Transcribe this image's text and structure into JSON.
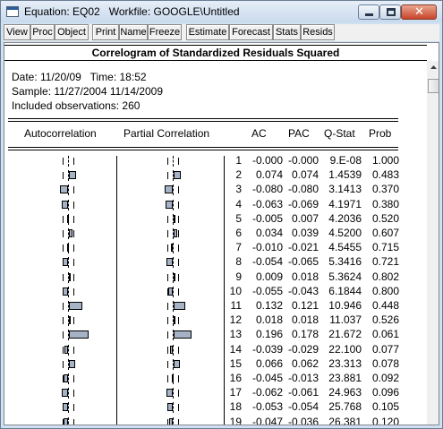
{
  "window": {
    "title": "Equation: EQ02   Workfile: GOOGLE\\Untitled",
    "close_glyph": "✕"
  },
  "toolbar": {
    "buttons": [
      "View",
      "Proc",
      "Object",
      "Print",
      "Name",
      "Freeze",
      "Estimate",
      "Forecast",
      "Stats",
      "Resids"
    ]
  },
  "report": {
    "heading": "Correlogram of Standardized Residuals Squared",
    "date_line": "Date: 11/20/09   Time: 18:52",
    "sample_line": "Sample: 11/27/2004 11/14/2009",
    "obs_line": "Included observations: 260",
    "columns": {
      "autocorrelation": "Autocorrelation",
      "partial_correlation": "Partial Correlation",
      "ac": "AC",
      "pac": "PAC",
      "qstat": "Q-Stat",
      "prob": "Prob"
    }
  },
  "rows": [
    {
      "lag": "1",
      "ac": "-0.000",
      "pac": "-0.000",
      "q": "9.E-08",
      "prob": "1.000",
      "ac_val": -0.0,
      "pac_val": -0.0
    },
    {
      "lag": "2",
      "ac": "0.074",
      "pac": "0.074",
      "q": "1.4539",
      "prob": "0.483",
      "ac_val": 0.074,
      "pac_val": 0.074
    },
    {
      "lag": "3",
      "ac": "-0.080",
      "pac": "-0.080",
      "q": "3.1413",
      "prob": "0.370",
      "ac_val": -0.08,
      "pac_val": -0.08
    },
    {
      "lag": "4",
      "ac": "-0.063",
      "pac": "-0.069",
      "q": "4.1971",
      "prob": "0.380",
      "ac_val": -0.063,
      "pac_val": -0.069
    },
    {
      "lag": "5",
      "ac": "-0.005",
      "pac": "0.007",
      "q": "4.2036",
      "prob": "0.520",
      "ac_val": -0.005,
      "pac_val": 0.007
    },
    {
      "lag": "6",
      "ac": "0.034",
      "pac": "0.039",
      "q": "4.5200",
      "prob": "0.607",
      "ac_val": 0.034,
      "pac_val": 0.039
    },
    {
      "lag": "7",
      "ac": "-0.010",
      "pac": "-0.021",
      "q": "4.5455",
      "prob": "0.715",
      "ac_val": -0.01,
      "pac_val": -0.021
    },
    {
      "lag": "8",
      "ac": "-0.054",
      "pac": "-0.065",
      "q": "5.3416",
      "prob": "0.721",
      "ac_val": -0.054,
      "pac_val": -0.065
    },
    {
      "lag": "9",
      "ac": "0.009",
      "pac": "0.018",
      "q": "5.3624",
      "prob": "0.802",
      "ac_val": 0.009,
      "pac_val": 0.018
    },
    {
      "lag": "10",
      "ac": "-0.055",
      "pac": "-0.043",
      "q": "6.1844",
      "prob": "0.800",
      "ac_val": -0.055,
      "pac_val": -0.043
    },
    {
      "lag": "11",
      "ac": "0.132",
      "pac": "0.121",
      "q": "10.946",
      "prob": "0.448",
      "ac_val": 0.132,
      "pac_val": 0.121
    },
    {
      "lag": "12",
      "ac": "0.018",
      "pac": "0.018",
      "q": "11.037",
      "prob": "0.526",
      "ac_val": 0.018,
      "pac_val": 0.018
    },
    {
      "lag": "13",
      "ac": "0.196",
      "pac": "0.178",
      "q": "21.672",
      "prob": "0.061",
      "ac_val": 0.196,
      "pac_val": 0.178
    },
    {
      "lag": "14",
      "ac": "-0.039",
      "pac": "-0.029",
      "q": "22.100",
      "prob": "0.077",
      "ac_val": -0.039,
      "pac_val": -0.029
    },
    {
      "lag": "15",
      "ac": "0.066",
      "pac": "0.062",
      "q": "23.313",
      "prob": "0.078",
      "ac_val": 0.066,
      "pac_val": 0.062
    },
    {
      "lag": "16",
      "ac": "-0.045",
      "pac": "-0.013",
      "q": "23.881",
      "prob": "0.092",
      "ac_val": -0.045,
      "pac_val": -0.013
    },
    {
      "lag": "17",
      "ac": "-0.062",
      "pac": "-0.061",
      "q": "24.963",
      "prob": "0.096",
      "ac_val": -0.062,
      "pac_val": -0.061
    },
    {
      "lag": "18",
      "ac": "-0.053",
      "pac": "-0.054",
      "q": "25.768",
      "prob": "0.105",
      "ac_val": -0.053,
      "pac_val": -0.054
    },
    {
      "lag": "19",
      "ac": "-0.047",
      "pac": "-0.036",
      "q": "26.381",
      "prob": "0.120",
      "ac_val": -0.047,
      "pac_val": -0.036
    }
  ],
  "icons": {
    "window_icon": "application-window-icon",
    "scroll_up": "scroll-up-arrow-icon"
  },
  "colors": {
    "bar_fill": "#a6b2c6",
    "title_bar": "#cfe0f1",
    "close_button": "#c7442a"
  }
}
